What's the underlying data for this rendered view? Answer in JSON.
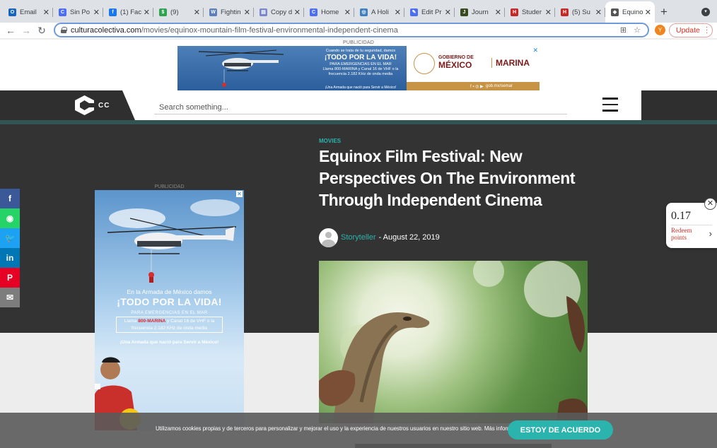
{
  "browser": {
    "tabs": [
      {
        "label": "Email",
        "color": "#1565c0",
        "glyph": "O"
      },
      {
        "label": "Sin Po",
        "color": "#4c6ef5",
        "glyph": "C"
      },
      {
        "label": "(1) Fac",
        "color": "#1877f2",
        "glyph": "f"
      },
      {
        "label": "(9)",
        "color": "#2ea44f",
        "glyph": "$"
      },
      {
        "label": "Fightin",
        "color": "#5b7fb9",
        "glyph": "W"
      },
      {
        "label": "Copy d",
        "color": "#7986cb",
        "glyph": "▤"
      },
      {
        "label": "Home",
        "color": "#4c6ef5",
        "glyph": "C"
      },
      {
        "label": "A Holi",
        "color": "#3f7fbf",
        "glyph": "◎"
      },
      {
        "label": "Edit Pr",
        "color": "#4c6ef5",
        "glyph": "✎"
      },
      {
        "label": "Journ",
        "color": "#3a4a1f",
        "glyph": "J"
      },
      {
        "label": "Studer",
        "color": "#c62828",
        "glyph": "H"
      },
      {
        "label": "(5) Su",
        "color": "#c62828",
        "glyph": "H"
      },
      {
        "label": "Equino",
        "color": "#555555",
        "glyph": "◆",
        "active": true
      }
    ],
    "tab_close": "✕",
    "new_tab": "+",
    "url_domain": "culturacolectiva.com",
    "url_path": "/movies/equinox-mountain-film-festival-environmental-independent-cinema",
    "avatar_letter": "Y",
    "update_label": "Update"
  },
  "top_ad": {
    "label": "PUBLICIDAD",
    "lead": "Cuando se trata de tu seguridad, damos",
    "headline": "¡TODO POR LA VIDA!",
    "sub": "PARA EMERGENCIAS EN EL MAR",
    "call": "Llama 800-MARINA y Canal 16 de VHF o la frecuencia 2.182 KHz de onda media",
    "motto": "¡Una Armada que nació para Servir a México!",
    "gob_small": "GOBIERNO DE",
    "gob_big": "MÉXICO",
    "marina": "MARINA",
    "footer": "gob.mx/semar",
    "close": "✕"
  },
  "header": {
    "logo_text": "CC",
    "search_placeholder": "Search something..."
  },
  "article": {
    "category": "MOVIES",
    "title": "Equinox Film Festival: New Perspectives On The Environment Through Independent Cinema",
    "author": "Storyteller",
    "date": "- August 22, 2019"
  },
  "side_ad": {
    "label": "PUBLICIDAD",
    "lead": "En la Armada de México damos",
    "headline": "¡TODO POR LA VIDA!",
    "sub": "PARA EMERGENCIAS EN EL MAR",
    "call_pre": "Llama ",
    "call_num": "800-MARINA",
    "call_post": " y Canal 16 de VHF o la frecuencia 2.182 KHz de onda media",
    "motto": "¡Una Armada que nació para Servir a México!",
    "close": "✕"
  },
  "social": [
    {
      "name": "facebook",
      "glyph": "f",
      "color": "#3b5998"
    },
    {
      "name": "whatsapp",
      "glyph": "◉",
      "color": "#25d366"
    },
    {
      "name": "twitter",
      "glyph": "🐦",
      "color": "#1da1f2"
    },
    {
      "name": "linkedin",
      "glyph": "in",
      "color": "#0077b5"
    },
    {
      "name": "pinterest",
      "glyph": "P",
      "color": "#e60023"
    },
    {
      "name": "email",
      "glyph": "✉",
      "color": "#7d7d7d"
    }
  ],
  "points_widget": {
    "value": "0.17",
    "label": "Redeem points",
    "close": "✕",
    "chevron": "›"
  },
  "cookie": {
    "message": "Utilizamos cookies propias y de terceros para personalizar y mejorar el uso y la experiencia de nuestros usuarios en nuestro sitio web. Más información",
    "accept": "ESTOY DE ACUERDO"
  },
  "colors": {
    "accent": "#2bb3ad",
    "header_dark": "#2f2f2f",
    "teal_bar": "#325453"
  }
}
